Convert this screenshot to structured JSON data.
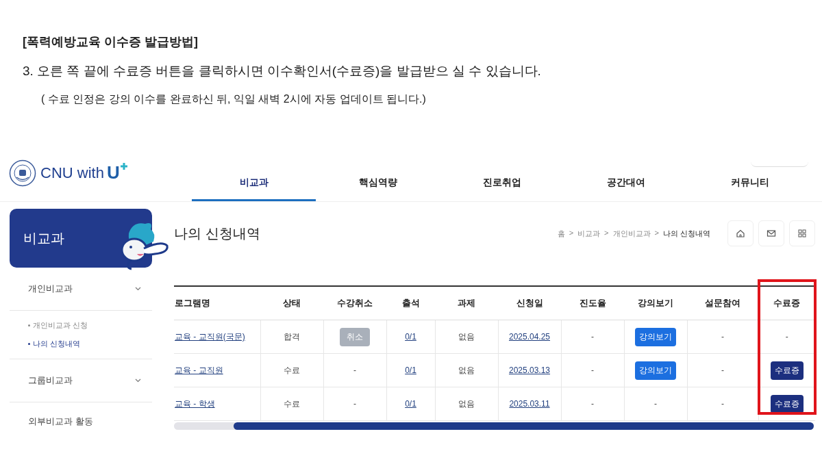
{
  "guide": {
    "heading": "[폭력예방교육 이수증 발급방법]",
    "step": "3. 오른 쪽 끝에 수료증 버튼을 클릭하시면 이수확인서(수료증)을 발급받으 실 수 있습니다.",
    "note": "( 수료 인정은 강의 이수를 완료하신 뒤, 익일 새벽 2시에 자동 업데이트 됩니다.)"
  },
  "site": {
    "logo": "CNU with",
    "logo_mark": "U",
    "nav": [
      {
        "label": "비교과",
        "selected": true
      },
      {
        "label": "핵심역량",
        "selected": false
      },
      {
        "label": "진로취업",
        "selected": false
      },
      {
        "label": "공간대여",
        "selected": false
      },
      {
        "label": "커뮤니티",
        "selected": false
      }
    ],
    "sidebar": {
      "title": "비교과",
      "items": [
        {
          "label": "개인비교과",
          "kind": "group",
          "children": [
            {
              "label": "개인비교과 신청",
              "selected": false
            },
            {
              "label": "나의 신청내역",
              "selected": true
            }
          ]
        },
        {
          "label": "그룹비교과",
          "kind": "group"
        },
        {
          "label": "외부비교과 활동",
          "kind": "link"
        }
      ]
    },
    "page_title": "나의 신청내역",
    "breadcrumb": [
      "홈",
      ">",
      "비교과",
      ">",
      "개인비교과",
      ">",
      "나의 신청내역"
    ],
    "table": {
      "columns": [
        "로그램명",
        "상태",
        "수강취소",
        "출석",
        "과제",
        "신청일",
        "진도율",
        "강의보기",
        "설문참여",
        "수료증"
      ],
      "rows": [
        [
          {
            "text": "교육 - 교직원(국문)",
            "kind": "link"
          },
          {
            "text": "합격",
            "kind": "text"
          },
          {
            "text": "취소",
            "kind": "gray-button"
          },
          {
            "text": "0/1",
            "kind": "link"
          },
          {
            "text": "없음",
            "kind": "text"
          },
          {
            "text": "2025.04.25",
            "kind": "link"
          },
          {
            "text": "-",
            "kind": "text"
          },
          {
            "text": "강의보기",
            "kind": "blue-button"
          },
          {
            "text": "-",
            "kind": "text"
          },
          {
            "text": "-",
            "kind": "text"
          }
        ],
        [
          {
            "text": "교육 - 교직원",
            "kind": "link"
          },
          {
            "text": "수료",
            "kind": "text"
          },
          {
            "text": "-",
            "kind": "text"
          },
          {
            "text": "0/1",
            "kind": "link"
          },
          {
            "text": "없음",
            "kind": "text"
          },
          {
            "text": "2025.03.13",
            "kind": "link"
          },
          {
            "text": "-",
            "kind": "text"
          },
          {
            "text": "강의보기",
            "kind": "blue-button"
          },
          {
            "text": "-",
            "kind": "text"
          },
          {
            "text": "수료증",
            "kind": "navy-button"
          }
        ],
        [
          {
            "text": "교육 - 학생",
            "kind": "link"
          },
          {
            "text": "수료",
            "kind": "text"
          },
          {
            "text": "-",
            "kind": "text"
          },
          {
            "text": "0/1",
            "kind": "link"
          },
          {
            "text": "없음",
            "kind": "text"
          },
          {
            "text": "2025.03.11",
            "kind": "link"
          },
          {
            "text": "-",
            "kind": "text"
          },
          {
            "text": "-",
            "kind": "text"
          },
          {
            "text": "-",
            "kind": "text"
          },
          {
            "text": "수료증",
            "kind": "navy-button"
          }
        ]
      ]
    }
  }
}
